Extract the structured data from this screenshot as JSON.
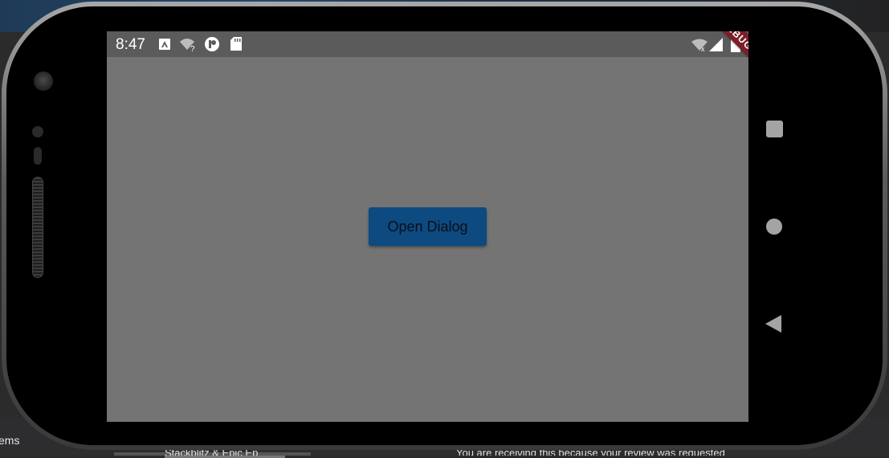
{
  "desktop": {
    "left_text": "ems",
    "mid_text": "Stackblitz & Epic Ep",
    "right_text": "You are receiving this because your review was requested"
  },
  "status_bar": {
    "time": "8:47",
    "icons": [
      "a-box-icon",
      "wifi-question-icon",
      "circle-p-icon",
      "sd-card-icon",
      "wifi-off-icon",
      "signal-icon",
      "battery-icon"
    ]
  },
  "debug_banner": "DEBUG",
  "main": {
    "open_dialog_label": "Open Dialog"
  },
  "nav": {
    "icons": [
      "recents-square-icon",
      "home-circle-icon",
      "back-triangle-icon"
    ]
  },
  "colors": {
    "screen_bg": "#747474",
    "status_bar_bg": "#5b5b5b",
    "button_bg": "#0d4a80",
    "debug_banner": "#7a1f2a"
  }
}
